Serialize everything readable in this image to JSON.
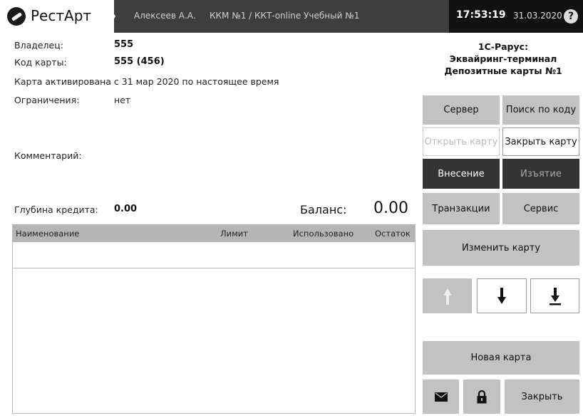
{
  "header": {
    "logo_text": "РестАрт",
    "user": "Алексеев А.А.",
    "kkm": "ККМ №1 / ККТ-online Учебный №1",
    "time": "17:53:19",
    "date": "31.03.2020",
    "help_label": "?"
  },
  "card": {
    "owner_label": "Владелец:",
    "owner_value": "555",
    "code_label": "Код карты:",
    "code_value": "555 (456)",
    "activated_text": "Карта активирована с 31 мар 2020 по настоящее время",
    "restrictions_label": "Ограничения:",
    "restrictions_value": "нет",
    "comment_label": "Комментарий:",
    "credit_label": "Глубина кредита:",
    "credit_value": "0.00",
    "balance_label": "Баланс:",
    "balance_value": "0.00"
  },
  "table": {
    "columns": [
      "Наименование",
      "Лимит",
      "Использовано",
      "Остаток"
    ]
  },
  "panel": {
    "title_line1": "1С-Рарус:",
    "title_line2": "Эквайринг-терминал",
    "title_line3": "Депозитные карты №1",
    "server": "Сервер",
    "search_by_code": "Поиск по коду",
    "open_card": "Открыть карту",
    "close_card": "Закрыть карту",
    "deposit": "Внесение",
    "withdraw": "Изъятие",
    "transactions": "Транзакции",
    "service": "Сервис",
    "change_card": "Изменить карту",
    "new_card": "Новая карта",
    "close": "Закрыть"
  },
  "colors": {
    "topbar": "#3e3e3e",
    "dark_button": "#333333",
    "gray_button": "#c2c2c2"
  }
}
